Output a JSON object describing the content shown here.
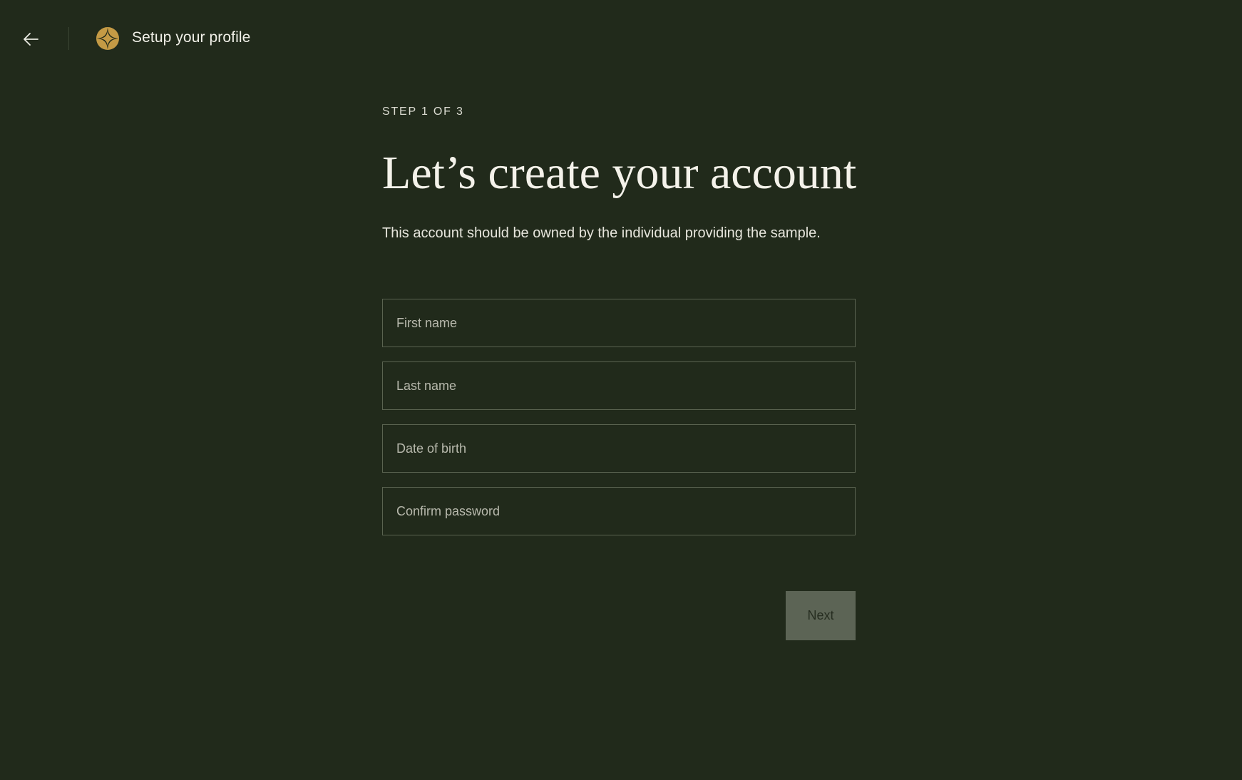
{
  "header": {
    "back_icon": "arrow-left-icon",
    "logo_icon": "compass-star-icon",
    "title": "Setup your profile"
  },
  "main": {
    "step_label": "STEP 1 OF 3",
    "title": "Let’s create your account",
    "subtitle": "This account should be owned by the individual providing the sample."
  },
  "form": {
    "fields": [
      {
        "placeholder": "First name",
        "value": ""
      },
      {
        "placeholder": "Last name",
        "value": ""
      },
      {
        "placeholder": "Date of birth",
        "value": ""
      },
      {
        "placeholder": "Confirm password",
        "value": ""
      }
    ],
    "next_label": "Next",
    "next_enabled": false
  },
  "colors": {
    "background": "#212a1b",
    "accent_gold": "#c49a45",
    "button_disabled": "#5c6455"
  }
}
